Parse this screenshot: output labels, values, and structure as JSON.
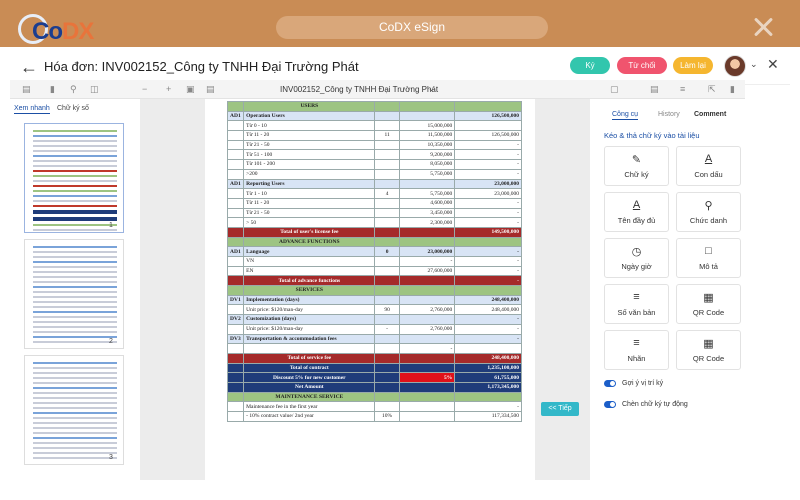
{
  "topbar": {
    "logo_c1": "Co",
    "logo_c2": "DX",
    "title": "CoDX eSign",
    "colors": {
      "bar": "#c98c55",
      "pill": "#d9a77a"
    }
  },
  "header": {
    "title": "Hóa đơn: INV002152_Công ty TNHH Đại Trường Phát",
    "buttons": {
      "sign": "Ký",
      "reject": "Từ chối",
      "redo": "Làm lại"
    },
    "colors": {
      "sign": "#32c6ad",
      "reject": "#f0546e",
      "redo": "#f5b62f"
    }
  },
  "toolbar": {
    "file_name": "INV002152_Công ty TNHH Đại Trường Phát"
  },
  "left_panel": {
    "tabs": [
      "Xem nhanh",
      "Chữ ký số"
    ],
    "pages": [
      "1",
      "2",
      "3"
    ]
  },
  "sheet": {
    "rows": [
      {
        "style": "green",
        "c0": "",
        "c1": "USERS",
        "c2": "",
        "c3": "",
        "c4": ""
      },
      {
        "style": "blue",
        "c0": "AD1",
        "c1": "Operation Users",
        "c2": "",
        "c3": "",
        "c4": "126,500,000"
      },
      {
        "style": "plain",
        "c0": "",
        "c1": "Từ 0 - 10",
        "c2": "",
        "c3": "15,000,000",
        "c4": ""
      },
      {
        "style": "plain",
        "c0": "",
        "c1": "Từ 11 - 20",
        "c2": "11",
        "c3": "11,500,000",
        "c4": "126,500,000"
      },
      {
        "style": "plain",
        "c0": "",
        "c1": "Từ 21 - 50",
        "c2": "",
        "c3": "10,350,000",
        "c4": "-"
      },
      {
        "style": "plain",
        "c0": "",
        "c1": "Từ 51 - 100",
        "c2": "",
        "c3": "9,200,000",
        "c4": "-"
      },
      {
        "style": "plain",
        "c0": "",
        "c1": "Từ 101 - 200",
        "c2": "",
        "c3": "8,050,000",
        "c4": "-"
      },
      {
        "style": "plain",
        "c0": "",
        "c1": ">200",
        "c2": "",
        "c3": "5,750,000",
        "c4": "-"
      },
      {
        "style": "blue",
        "c0": "AD1",
        "c1": "Reporting Users",
        "c2": "",
        "c3": "",
        "c4": "23,000,000"
      },
      {
        "style": "plain",
        "c0": "",
        "c1": "Từ 1 - 10",
        "c2": "4",
        "c3": "5,750,000",
        "c4": "23,000,000"
      },
      {
        "style": "plain",
        "c0": "",
        "c1": "Từ 11 - 20",
        "c2": "",
        "c3": "4,600,000",
        "c4": "-"
      },
      {
        "style": "plain",
        "c0": "",
        "c1": "Từ 21 - 50",
        "c2": "",
        "c3": "3,450,000",
        "c4": "-"
      },
      {
        "style": "plain",
        "c0": "",
        "c1": "> 50",
        "c2": "",
        "c3": "2,300,000",
        "c4": "-"
      },
      {
        "style": "red",
        "c0": "",
        "c1": "Total of user's license fee",
        "c2": "",
        "c3": "",
        "c4": "149,500,000"
      },
      {
        "style": "green",
        "c0": "",
        "c1": "ADVANCE FUNCTIONS",
        "c2": "",
        "c3": "",
        "c4": ""
      },
      {
        "style": "blue",
        "c0": "AD1",
        "c1": "Language",
        "c2": "0",
        "c3": "23,000,000",
        "c4": "-"
      },
      {
        "style": "plain",
        "c0": "",
        "c1": "VN",
        "c2": "",
        "c3": "-",
        "c4": "-"
      },
      {
        "style": "plain",
        "c0": "",
        "c1": "EN",
        "c2": "",
        "c3": "27,600,000",
        "c4": "-"
      },
      {
        "style": "red",
        "c0": "",
        "c1": "Total of advance functions",
        "c2": "",
        "c3": "",
        "c4": "-"
      },
      {
        "style": "green",
        "c0": "",
        "c1": "SERVICES",
        "c2": "",
        "c3": "",
        "c4": ""
      },
      {
        "style": "blue",
        "c0": "DV1",
        "c1": "Implementation (days)",
        "c2": "",
        "c3": "",
        "c4": "248,400,000"
      },
      {
        "style": "plain",
        "c0": "",
        "c1": "Unit price: $120/man-day",
        "c2": "90",
        "c3": "2,760,000",
        "c4": "248,400,000"
      },
      {
        "style": "blue",
        "c0": "DV2",
        "c1": "Customization (days)",
        "c2": "",
        "c3": "",
        "c4": "-"
      },
      {
        "style": "plain",
        "c0": "",
        "c1": "Unit price: $120/man-day",
        "c2": "-",
        "c3": "2,760,000",
        "c4": "-"
      },
      {
        "style": "blue",
        "c0": "DV3",
        "c1": "Transportation & accommodation fees",
        "c2": "",
        "c3": "",
        "c4": "-"
      },
      {
        "style": "plain",
        "c0": "",
        "c1": "",
        "c2": "",
        "c3": "-",
        "c4": ""
      },
      {
        "style": "red",
        "c0": "",
        "c1": "Total of service fee",
        "c2": "",
        "c3": "",
        "c4": "248,400,000"
      },
      {
        "style": "navy",
        "c0": "",
        "c1": "Total of contract",
        "c2": "",
        "c3": "",
        "c4": "1,235,100,000"
      },
      {
        "style": "navy",
        "c0": "",
        "c1": "Discount 5% for new customer",
        "c2": "",
        "c3": "5%",
        "c4": "61,755,000"
      },
      {
        "style": "navy",
        "c0": "",
        "c1": "Net Amount",
        "c2": "",
        "c3": "",
        "c4": "1,173,345,000"
      },
      {
        "style": "green",
        "c0": "",
        "c1": "MAINTENANCE SERVICE",
        "c2": "",
        "c3": "",
        "c4": ""
      },
      {
        "style": "plain",
        "c0": "",
        "c1": "Maintenance fee in the first year",
        "c2": "",
        "c3": "",
        "c4": "-"
      },
      {
        "style": "plain",
        "c0": "",
        "c1": "- 10% contract value/ 2nd year",
        "c2": "10%",
        "c3": "",
        "c4": "117,334,500"
      }
    ]
  },
  "next_button": "<< Tiếp",
  "right_panel": {
    "tabs": [
      "Công cụ",
      "History",
      "Comment"
    ],
    "heading": "Kéo & thả chữ ký vào tài liệu",
    "tools": [
      {
        "label": "Chữ ký",
        "icon": "pen-icon"
      },
      {
        "label": "Con dấu",
        "icon": "stamp-icon"
      },
      {
        "label": "Tên đầy đủ",
        "icon": "text-a-icon"
      },
      {
        "label": "Chức danh",
        "icon": "pin-icon"
      },
      {
        "label": "Ngày giờ",
        "icon": "clock-icon"
      },
      {
        "label": "Mô tả",
        "icon": "comment-icon"
      },
      {
        "label": "Số văn bản",
        "icon": "lines-icon"
      },
      {
        "label": "QR Code",
        "icon": "qr-icon"
      },
      {
        "label": "Nhãn",
        "icon": "lines-icon"
      },
      {
        "label": "QR Code",
        "icon": "qr-icon"
      }
    ],
    "toggles": [
      {
        "label": "Gợi ý vị trí ký",
        "on": true
      },
      {
        "label": "Chèn chữ ký tự động",
        "on": true
      }
    ]
  }
}
